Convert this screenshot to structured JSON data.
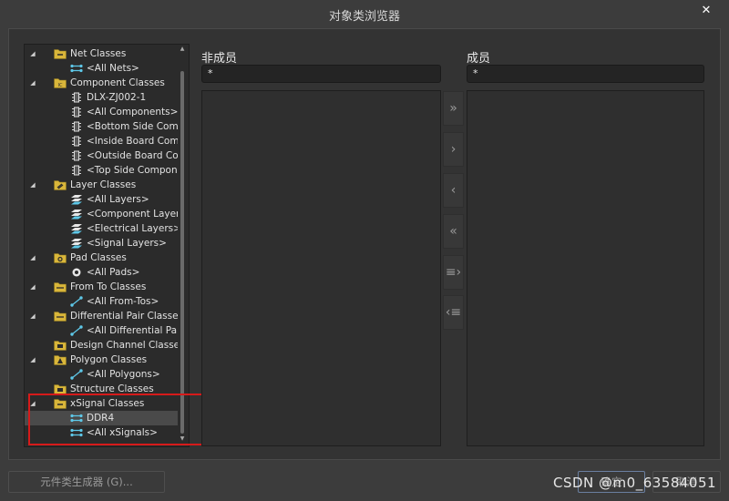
{
  "window": {
    "title": "对象类浏览器",
    "close_glyph": "✕"
  },
  "tree": [
    {
      "level": 0,
      "expander": "◢",
      "icon": "folder-net",
      "label": "Net Classes"
    },
    {
      "level": 1,
      "icon": "net",
      "label": "<All Nets>"
    },
    {
      "level": 0,
      "expander": "◢",
      "icon": "folder-component",
      "label": "Component Classes"
    },
    {
      "level": 1,
      "icon": "component",
      "label": "DLX-ZJ002-1"
    },
    {
      "level": 1,
      "icon": "component",
      "label": "<All Components>"
    },
    {
      "level": 1,
      "icon": "component",
      "label": "<Bottom Side Comp"
    },
    {
      "level": 1,
      "icon": "component",
      "label": "<Inside Board Com"
    },
    {
      "level": 1,
      "icon": "component",
      "label": "<Outside Board Co"
    },
    {
      "level": 1,
      "icon": "component",
      "label": "<Top Side Compon"
    },
    {
      "level": 0,
      "expander": "◢",
      "icon": "folder-layer",
      "label": "Layer Classes"
    },
    {
      "level": 1,
      "icon": "layer",
      "label": "<All Layers>"
    },
    {
      "level": 1,
      "icon": "layer",
      "label": "<Component Layer"
    },
    {
      "level": 1,
      "icon": "layer",
      "label": "<Electrical Layers>"
    },
    {
      "level": 1,
      "icon": "layer",
      "label": "<Signal Layers>"
    },
    {
      "level": 0,
      "expander": "◢",
      "icon": "folder-pad",
      "label": "Pad Classes"
    },
    {
      "level": 1,
      "icon": "pad",
      "label": "<All Pads>"
    },
    {
      "level": 0,
      "expander": "◢",
      "icon": "folder-fromto",
      "label": "From To Classes"
    },
    {
      "level": 1,
      "icon": "fromto",
      "label": "<All From-Tos>"
    },
    {
      "level": 0,
      "expander": "◢",
      "icon": "folder-diffpair",
      "label": "Differential Pair Classe"
    },
    {
      "level": 1,
      "icon": "fromto",
      "label": "<All Differential Pai"
    },
    {
      "level": 0,
      "expander": "",
      "icon": "folder-channel",
      "label": "Design Channel Classe"
    },
    {
      "level": 0,
      "expander": "◢",
      "icon": "folder-polygon",
      "label": "Polygon Classes"
    },
    {
      "level": 1,
      "icon": "fromto",
      "label": "<All Polygons>"
    },
    {
      "level": 0,
      "expander": "",
      "icon": "folder-structure",
      "label": "Structure Classes"
    },
    {
      "level": 0,
      "expander": "◢",
      "icon": "folder-xsignal",
      "label": "xSignal Classes"
    },
    {
      "level": 1,
      "icon": "net",
      "label": "DDR4",
      "selected": true
    },
    {
      "level": 1,
      "icon": "net",
      "label": "<All xSignals>"
    }
  ],
  "non_members": {
    "heading": "非成员",
    "filter_value": "*"
  },
  "members": {
    "heading": "成员",
    "filter_value": "*"
  },
  "move_buttons": [
    {
      "name": "move-all-right-button",
      "glyph": "»"
    },
    {
      "name": "move-right-button",
      "glyph": "›"
    },
    {
      "name": "move-left-button",
      "glyph": "‹"
    },
    {
      "name": "move-all-left-button",
      "glyph": "«"
    },
    {
      "name": "move-selected-right-button",
      "glyph": "≡›"
    },
    {
      "name": "move-selected-left-button",
      "glyph": "‹≡"
    }
  ],
  "footer": {
    "generator_label": "元件类生成器 (G)...",
    "ok_label": "确定",
    "cancel_label": "取消"
  },
  "watermark": "CSDN @m0_63584051",
  "colors": {
    "highlight_box": "#d61a1a",
    "folder_yellow": "#d9b63a",
    "icon_cyan": "#5ec8e8"
  }
}
